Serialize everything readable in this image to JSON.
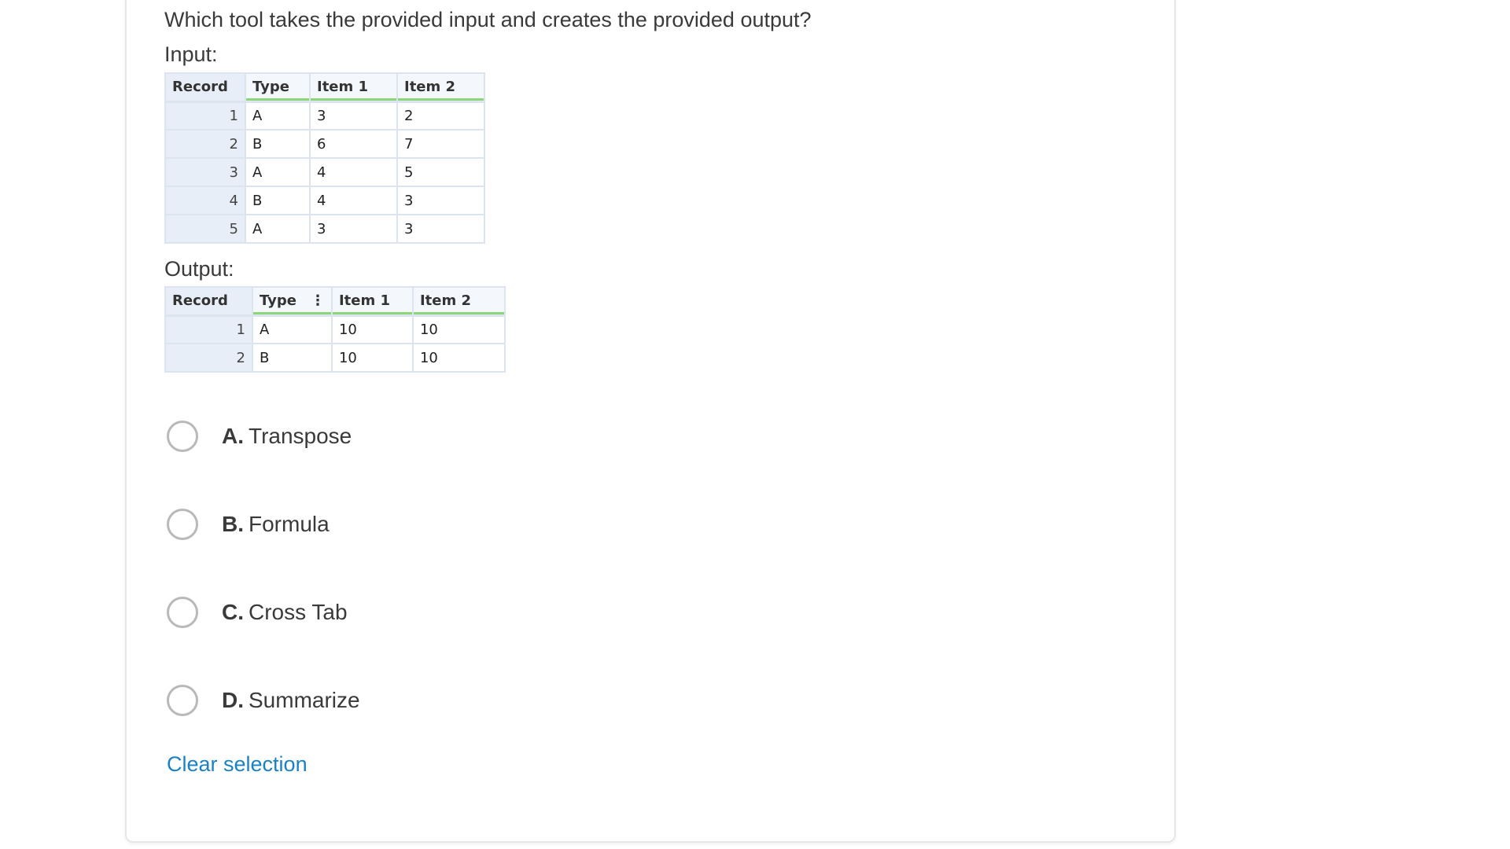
{
  "question": "Which tool takes the provided input and creates the provided output?",
  "input_label": "Input:",
  "output_label": "Output:",
  "input_table": {
    "headers": [
      "Record",
      "Type",
      "Item 1",
      "Item 2"
    ],
    "rows": [
      [
        "1",
        "A",
        "3",
        "2"
      ],
      [
        "2",
        "B",
        "6",
        "7"
      ],
      [
        "3",
        "A",
        "4",
        "5"
      ],
      [
        "4",
        "B",
        "4",
        "3"
      ],
      [
        "5",
        "A",
        "3",
        "3"
      ]
    ]
  },
  "output_table": {
    "headers": [
      "Record",
      "Type",
      "Item 1",
      "Item 2"
    ],
    "header_menu_glyph": "⋮",
    "rows": [
      [
        "1",
        "A",
        "10",
        "10"
      ],
      [
        "2",
        "B",
        "10",
        "10"
      ]
    ]
  },
  "options": [
    {
      "letter": "A.",
      "label": "Transpose"
    },
    {
      "letter": "B.",
      "label": "Formula"
    },
    {
      "letter": "C.",
      "label": "Cross Tab"
    },
    {
      "letter": "D.",
      "label": "Summarize"
    }
  ],
  "clear_selection": "Clear selection",
  "colors": {
    "link": "#1a82c4",
    "radio_border": "#b9b9b9",
    "grid_border": "#dce4ef",
    "typed_underline": "#8ed67a"
  }
}
